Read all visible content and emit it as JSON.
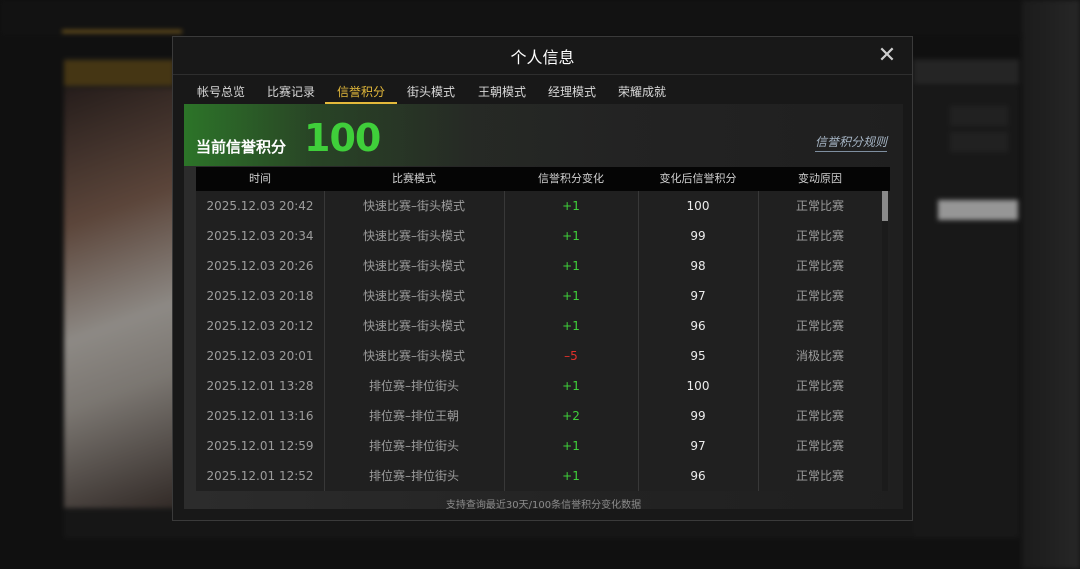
{
  "modal": {
    "title": "个人信息",
    "tabs": [
      {
        "label": "帐号总览"
      },
      {
        "label": "比赛记录"
      },
      {
        "label": "信誉积分"
      },
      {
        "label": "街头模式"
      },
      {
        "label": "王朝模式"
      },
      {
        "label": "经理模式"
      },
      {
        "label": "荣耀成就"
      }
    ],
    "active_tab": "信誉积分",
    "hero": {
      "label": "当前信誉积分",
      "score": "100",
      "rules_link": "信誉积分规则"
    },
    "table": {
      "headers": [
        "时间",
        "比赛模式",
        "信誉积分变化",
        "变化后信誉积分",
        "变动原因"
      ],
      "rows": [
        {
          "time": "2025.12.03  20:42",
          "mode": "快速比赛–街头模式",
          "change": "+1",
          "after": "100",
          "reason": "正常比赛"
        },
        {
          "time": "2025.12.03  20:34",
          "mode": "快速比赛–街头模式",
          "change": "+1",
          "after": "99",
          "reason": "正常比赛"
        },
        {
          "time": "2025.12.03  20:26",
          "mode": "快速比赛–街头模式",
          "change": "+1",
          "after": "98",
          "reason": "正常比赛"
        },
        {
          "time": "2025.12.03  20:18",
          "mode": "快速比赛–街头模式",
          "change": "+1",
          "after": "97",
          "reason": "正常比赛"
        },
        {
          "time": "2025.12.03  20:12",
          "mode": "快速比赛–街头模式",
          "change": "+1",
          "after": "96",
          "reason": "正常比赛"
        },
        {
          "time": "2025.12.03  20:01",
          "mode": "快速比赛–街头模式",
          "change": "–5",
          "after": "95",
          "reason": "消极比赛"
        },
        {
          "time": "2025.12.01  13:28",
          "mode": "排位赛–排位街头",
          "change": "+1",
          "after": "100",
          "reason": "正常比赛"
        },
        {
          "time": "2025.12.01  13:16",
          "mode": "排位赛–排位王朝",
          "change": "+2",
          "after": "99",
          "reason": "正常比赛"
        },
        {
          "time": "2025.12.01  12:59",
          "mode": "排位赛–排位街头",
          "change": "+1",
          "after": "97",
          "reason": "正常比赛"
        },
        {
          "time": "2025.12.01  12:52",
          "mode": "排位赛–排位街头",
          "change": "+1",
          "after": "96",
          "reason": "正常比赛"
        }
      ]
    },
    "footer_note": "支持查询最近30天/100条信誉积分变化数据"
  },
  "colors": {
    "positive": "#3fcf3a",
    "negative": "#e0302a",
    "accent_gold": "#e3b93b",
    "score_green": "#3fcf3a"
  },
  "icons": {
    "close": "close-icon"
  }
}
